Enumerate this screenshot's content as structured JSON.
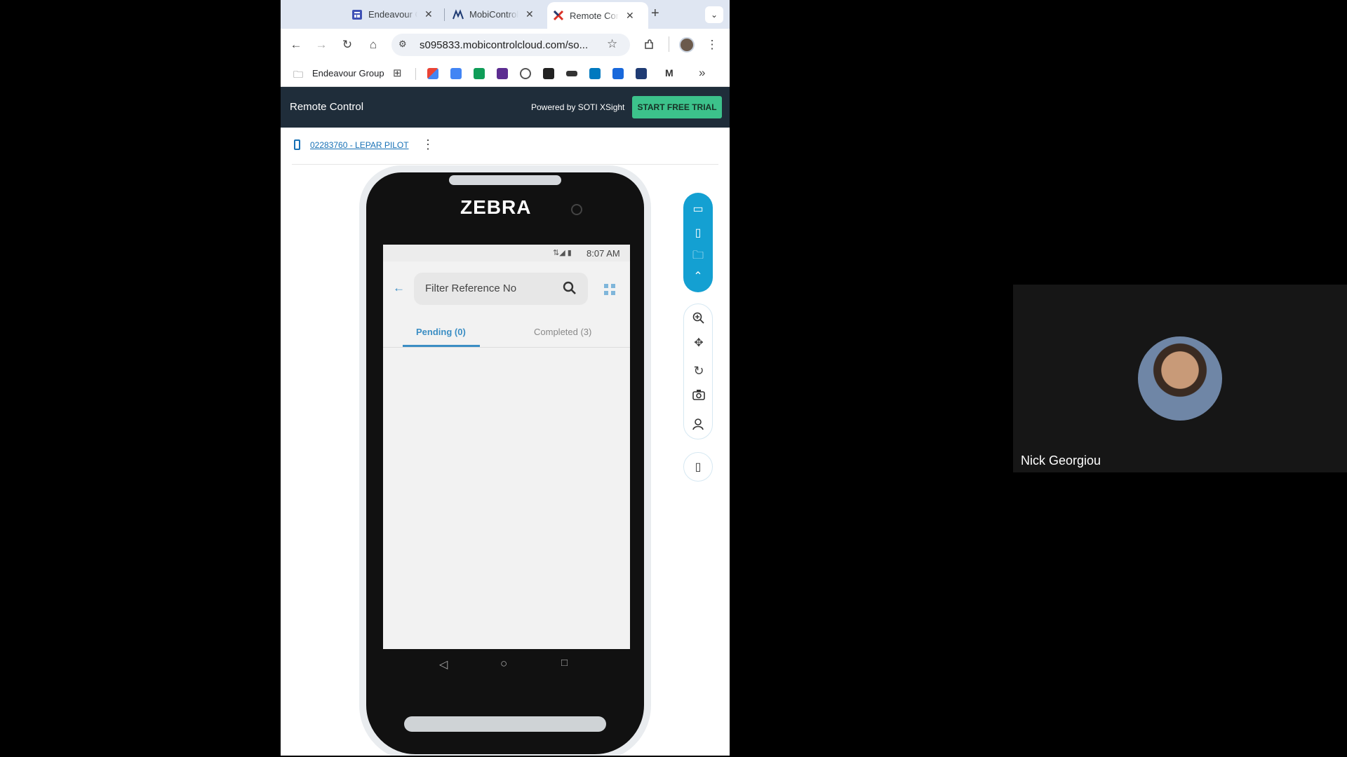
{
  "browser": {
    "tabs": [
      {
        "title": "Endeavour Group",
        "icon": "forms-icon"
      },
      {
        "title": "MobiControl",
        "icon": "mobicontrol-icon"
      },
      {
        "title": "Remote Control",
        "icon": "soti-icon",
        "active": true
      }
    ],
    "new_tab": "+",
    "url": "s095833.mobicontrolcloud.com/so...",
    "bookmarks": {
      "folder_label": "Endeavour Group",
      "more": "»"
    }
  },
  "remote_control": {
    "title": "Remote Control",
    "powered_by": "Powered by SOTI XSight",
    "trial_button": "START FREE TRIAL",
    "device_name": "02283760 - LEPAR PILOT"
  },
  "device": {
    "brand": "ZEBRA",
    "time": "8:07 AM",
    "search_placeholder": "Filter Reference No",
    "tabs": [
      {
        "label": "Pending (0)",
        "active": true
      },
      {
        "label": "Completed (3)",
        "active": false
      }
    ]
  },
  "meeting": {
    "participant_name": "Nick Georgiou"
  },
  "colors": {
    "rc_header": "#1f2d3a",
    "accent_teal": "#3cc28b",
    "toolbar_blue": "#14a0d2",
    "app_tab_blue": "#3b8ec4"
  }
}
